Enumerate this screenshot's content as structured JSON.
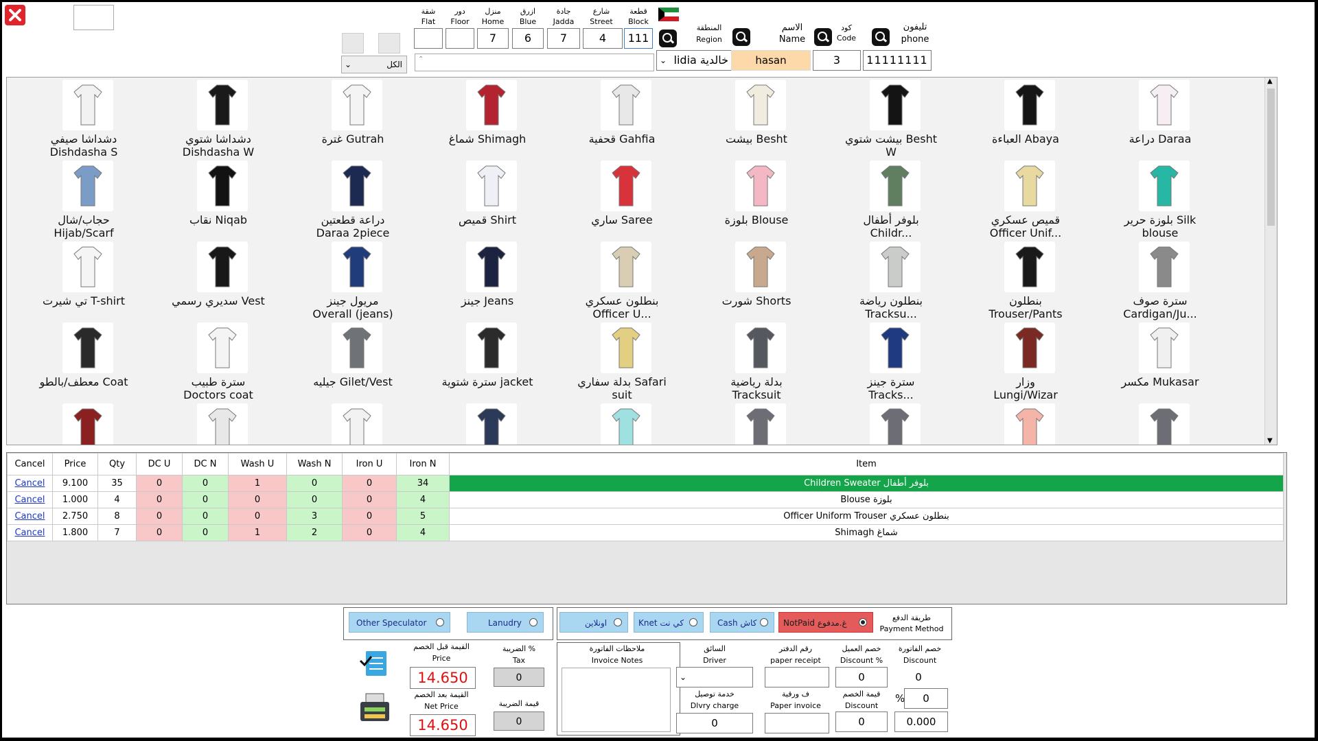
{
  "top": {
    "address": [
      {
        "ar": "شقة",
        "en": "Flat",
        "value": ""
      },
      {
        "ar": "دور",
        "en": "Floor",
        "value": ""
      },
      {
        "ar": "منزل",
        "en": "Home",
        "value": "7"
      },
      {
        "ar": "ازرق",
        "en": "Blue",
        "value": "6"
      },
      {
        "ar": "جادة",
        "en": "Jadda",
        "value": "7"
      },
      {
        "ar": "شارع",
        "en": "Street",
        "value": "4"
      },
      {
        "ar": "قطعة",
        "en": "Block",
        "value": "111"
      }
    ],
    "region": {
      "ar": "المنطقة",
      "en": "Region",
      "value": "lidia خالدية"
    },
    "name": {
      "ar": "الاسم",
      "en": "Name",
      "value": "hasan"
    },
    "code": {
      "ar": "كود",
      "en": "Code",
      "value": "3"
    },
    "phone": {
      "ar": "تليفون",
      "en": "phone",
      "value": "11111111"
    },
    "filter": "الكل"
  },
  "items": [
    {
      "l1": "دشداشا صيفي",
      "l2": "Dishdasha S",
      "icon": "white-dishdasha"
    },
    {
      "l1": "دشداشا شتوي",
      "l2": "Dishdasha W",
      "icon": "black-dishdasha"
    },
    {
      "l1": "غترة Gutrah",
      "l2": "",
      "icon": "gutrah"
    },
    {
      "l1": "شماغ  Shimagh",
      "l2": "",
      "icon": "shimagh"
    },
    {
      "l1": "قحفية Gahfia",
      "l2": "",
      "icon": "gahfia"
    },
    {
      "l1": "بيشت Besht",
      "l2": "",
      "icon": "besht"
    },
    {
      "l1": "بيشت شتوي Besht",
      "l2": "W",
      "icon": "besht-winter"
    },
    {
      "l1": "العباءة Abaya",
      "l2": "",
      "icon": "abaya"
    },
    {
      "l1": "دراعة Daraa",
      "l2": "",
      "icon": "daraa"
    },
    {
      "l1": "حجاب/شال",
      "l2": "Hijab/Scarf",
      "icon": "hijab"
    },
    {
      "l1": "نقاب Niqab",
      "l2": "",
      "icon": "niqab"
    },
    {
      "l1": "دراعة قطعتين",
      "l2": "Daraa 2piece",
      "icon": "daraa-2piece"
    },
    {
      "l1": "قميص Shirt",
      "l2": "",
      "icon": "shirt"
    },
    {
      "l1": "ساري Saree",
      "l2": "",
      "icon": "saree"
    },
    {
      "l1": "بلوزة Blouse",
      "l2": "",
      "icon": "blouse"
    },
    {
      "l1": "بلوفر أطفال",
      "l2": "Childr...",
      "icon": "children-sweater"
    },
    {
      "l1": "قميص عسكري",
      "l2": "Officer Unif...",
      "icon": "officer-uniform"
    },
    {
      "l1": "بلوزة حرير Silk",
      "l2": "blouse",
      "icon": "silk-blouse"
    },
    {
      "l1": "تي شيرت T-shirt",
      "l2": "",
      "icon": "tshirt"
    },
    {
      "l1": "سديري رسمي Vest",
      "l2": "",
      "icon": "vest"
    },
    {
      "l1": "مريول جينز",
      "l2": "Overall (jeans)",
      "icon": "overall"
    },
    {
      "l1": "جينز Jeans",
      "l2": "",
      "icon": "jeans"
    },
    {
      "l1": "بنطلون عسكري",
      "l2": "Officer U...",
      "icon": "officer-trouser"
    },
    {
      "l1": "شورت Shorts",
      "l2": "",
      "icon": "shorts"
    },
    {
      "l1": "بنطلون رياضة",
      "l2": "Tracksu...",
      "icon": "tracksuit-pants"
    },
    {
      "l1": "بنطلون",
      "l2": "Trouser/Pants",
      "icon": "trouser"
    },
    {
      "l1": "سترة صوف",
      "l2": "Cardigan/Ju...",
      "icon": "cardigan"
    },
    {
      "l1": "معطف/بالطو Coat",
      "l2": "",
      "icon": "coat"
    },
    {
      "l1": "سترة طبيب",
      "l2": "Doctors coat",
      "icon": "doctor-coat"
    },
    {
      "l1": "جيليه Gilet/Vest",
      "l2": "",
      "icon": "gilet"
    },
    {
      "l1": "سترة شتوية jacket",
      "l2": "",
      "icon": "jacket"
    },
    {
      "l1": "بدلة سفاري Safari",
      "l2": "suit",
      "icon": "safari-suit"
    },
    {
      "l1": "بدلة رياضية",
      "l2": "Tracksuit",
      "icon": "tracksuit"
    },
    {
      "l1": "سترة جينز",
      "l2": "Tracks...",
      "icon": "jeans-jacket"
    },
    {
      "l1": "وزار",
      "l2": "Lungi/Wizar",
      "icon": "lungi"
    },
    {
      "l1": "مكسر Mukasar",
      "l2": "",
      "icon": "mukasar"
    },
    {
      "l1": "",
      "l2": "",
      "icon": "dress-red"
    },
    {
      "l1": "",
      "l2": "",
      "icon": "socks"
    },
    {
      "l1": "",
      "l2": "",
      "icon": "undershirt"
    },
    {
      "l1": "",
      "l2": "",
      "icon": "briefs"
    },
    {
      "l1": "",
      "l2": "",
      "icon": "kids-dress"
    },
    {
      "l1": "",
      "l2": "",
      "icon": "grey-dress"
    },
    {
      "l1": "",
      "l2": "",
      "icon": "grey-dress"
    },
    {
      "l1": "",
      "l2": "",
      "icon": "pink-dress"
    },
    {
      "l1": "",
      "l2": "",
      "icon": "grey-dress"
    },
    {
      "l1": "",
      "l2": "",
      "icon": "pink-skirt"
    }
  ],
  "table": {
    "headers": [
      "Cancel",
      "Price",
      "Qty",
      "DC U",
      "DC N",
      "Wash U",
      "Wash N",
      "Iron U",
      "Iron N",
      "Item"
    ],
    "rows": [
      {
        "cancel": "Cancel",
        "price": "9.100",
        "qty": "35",
        "dcu": "0",
        "dcn": "0",
        "washu": "1",
        "washn": "0",
        "ironu": "0",
        "ironn": "34",
        "item": "Children Sweater بلوفر أطفال",
        "selected": true
      },
      {
        "cancel": "Cancel",
        "price": "1.000",
        "qty": "4",
        "dcu": "0",
        "dcn": "0",
        "washu": "0",
        "washn": "0",
        "ironu": "0",
        "ironn": "4",
        "item": "Blouse بلوزة",
        "selected": false
      },
      {
        "cancel": "Cancel",
        "price": "2.750",
        "qty": "8",
        "dcu": "0",
        "dcn": "0",
        "washu": "0",
        "washn": "3",
        "ironu": "0",
        "ironn": "5",
        "item": "Officer Uniform Trouser بنطلون عسكري",
        "selected": false
      },
      {
        "cancel": "Cancel",
        "price": "1.800",
        "qty": "7",
        "dcu": "0",
        "dcn": "0",
        "washu": "1",
        "washn": "2",
        "ironu": "0",
        "ironn": "4",
        "item": "Shimagh  شماغ",
        "selected": false
      }
    ]
  },
  "bottom": {
    "speculator": "Other Speculator",
    "laundry": "Lanudry",
    "pm_online": "اونلاين",
    "pm_knet": "Knet كي نت",
    "pm_cash": "Cash كاش",
    "pm_notpaid": "NotPaid غ.مدفوع",
    "pm_label_ar": "طريقة الدفع",
    "pm_label_en": "Payment Method",
    "price_before_ar": "القيمة قبل الخصم",
    "price_before_en": "Price",
    "price_before": "14.650",
    "net_ar": "القيمة بعد الخصم",
    "net_en": "Net Price",
    "net": "14.650",
    "tax_ar": "الضريبة %",
    "tax_en": "Tax",
    "tax": "0",
    "taxval_ar": "قيمة الضريبة",
    "taxval": "0",
    "notes_ar": "ملاحظات الفاتورة",
    "notes_en": "Invoice Notes",
    "driver_ar": "السائق",
    "driver_en": "Driver",
    "dlv_ar": "خدمة توصيل",
    "dlv_en": "Dlvry charge",
    "dlv": "0",
    "paper_ar": "رقم الدفتر",
    "paper_en": "paper receipt",
    "pinv_ar": "ف ورقية",
    "pinv_en": "Paper invoice",
    "custdisc_ar": "خصم العميل",
    "custdisc_en": "Discount %",
    "custdisc": "0",
    "discval_ar": "قيمة الخصم",
    "discval_en": "Discount",
    "discval": "0",
    "invdisc_ar": "خصم الفاتورة",
    "invdisc_en": "Discount",
    "invdisc": "0",
    "pct_sign": "%",
    "pct": "0",
    "amount": "0.000"
  }
}
